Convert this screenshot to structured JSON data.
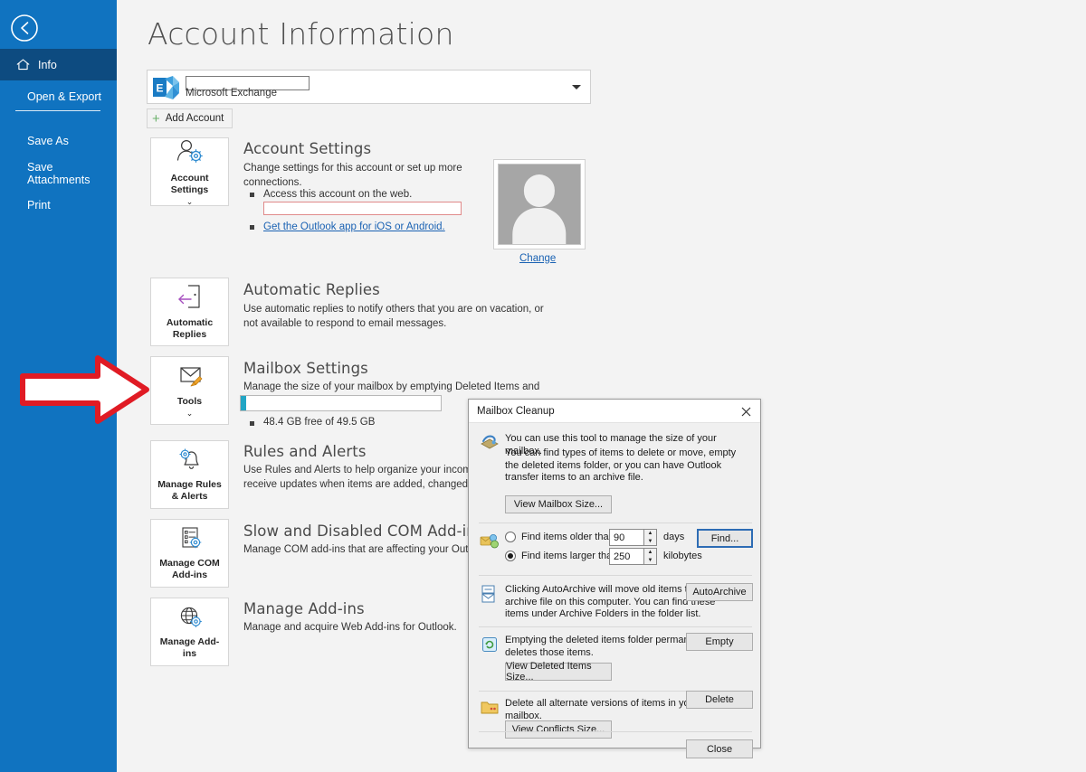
{
  "sidebar": {
    "back_icon": "back-arrow-icon",
    "items": [
      {
        "label": "Info",
        "icon": "home-icon",
        "selected": true
      },
      {
        "label": "Open & Export",
        "icon": "",
        "selected": false
      },
      {
        "label": "Save As",
        "icon": "",
        "selected": false
      },
      {
        "label": "Save Attachments",
        "icon": "",
        "selected": false
      },
      {
        "label": "Print",
        "icon": "",
        "selected": false
      }
    ]
  },
  "main": {
    "page_title": "Account Information",
    "account_selector": {
      "email_value": "",
      "account_type": "Microsoft Exchange",
      "logo_letter": "E",
      "caret_icon": "chevron-down-icon"
    },
    "add_account_label": "Add Account",
    "sections": [
      {
        "tile_label": "Account Settings",
        "tile_icon": "person-gear-icon",
        "tile_has_chevron": true,
        "title": "Account Settings",
        "desc": "Change settings for this account or set up more connections.",
        "bullets": [
          {
            "text": "Access this account on the web.",
            "link": false
          },
          {
            "text": "Get the Outlook app for iOS or Android.",
            "link": true
          }
        ]
      },
      {
        "tile_label": "Automatic Replies",
        "tile_icon": "door-exit-icon",
        "tile_has_chevron": false,
        "title": "Automatic Replies",
        "desc": "Use automatic replies to notify others that you are on vacation, or not available to respond to email messages.",
        "bullets": []
      },
      {
        "tile_label": "Tools",
        "tile_icon": "mailbox-broom-icon",
        "tile_has_chevron": true,
        "title": "Mailbox Settings",
        "desc": "Manage the size of your mailbox by emptying Deleted Items and archiving.",
        "usage_text": "48.4 GB free of 49.5 GB",
        "usage_percent": 2
      },
      {
        "tile_label": "Manage Rules & Alerts",
        "tile_icon": "bell-gear-icon",
        "tile_has_chevron": false,
        "title": "Rules and Alerts",
        "desc": "Use Rules and Alerts to help organize your incoming email messages, and receive updates when items are added, changed, or removed.",
        "bullets": []
      },
      {
        "tile_label": "Manage COM Add-ins",
        "tile_icon": "list-gear-icon",
        "tile_has_chevron": false,
        "title": "Slow and Disabled COM Add-ins",
        "desc": "Manage COM add-ins that are affecting your Outlook experience.",
        "bullets": []
      },
      {
        "tile_label": "Manage Add-ins",
        "tile_icon": "globe-gear-icon",
        "tile_has_chevron": false,
        "title": "Manage Add-ins",
        "desc": "Manage and acquire Web Add-ins for Outlook.",
        "bullets": []
      }
    ],
    "profile": {
      "avatar_icon": "user-avatar-placeholder",
      "change_label": "Change"
    }
  },
  "dialog": {
    "title": "Mailbox Cleanup",
    "close_icon": "close-icon",
    "section_info": {
      "icon": "mailbox-tool-icon",
      "line1": "You can use this tool to manage the size of your mailbox.",
      "line2": "You can find types of items to delete or move, empty the deleted items folder, or you can have Outlook transfer items to an archive file.",
      "button": "View Mailbox Size..."
    },
    "section_find": {
      "icon": "find-items-icon",
      "older_label": "Find items older than",
      "older_value": "90",
      "older_unit": "days",
      "older_selected": false,
      "larger_label": "Find items larger than",
      "larger_value": "250",
      "larger_unit": "kilobytes",
      "larger_selected": true,
      "find_button": "Find..."
    },
    "section_archive": {
      "icon": "autoarchive-icon",
      "text": "Clicking AutoArchive will move old items to the archive file on this computer. You can find these items under Archive Folders in the folder list.",
      "button": "AutoArchive"
    },
    "section_deleted": {
      "icon": "recycle-bin-icon",
      "text": "Emptying the deleted items folder permanently deletes those items.",
      "button": "Empty",
      "sub_button": "View Deleted Items Size..."
    },
    "section_conflicts": {
      "icon": "conflicts-folder-icon",
      "text": "Delete all alternate versions of items in your mailbox.",
      "button": "Delete",
      "sub_button": "View Conflicts Size..."
    },
    "close_button": "Close"
  },
  "annotation": {
    "arrow_icon": "red-arrow-pointing-right",
    "arrow_color": "#e01b24"
  },
  "colors": {
    "sidebar_blue": "#1073c0",
    "sidebar_selected": "#0d4b80",
    "accent_link": "#1a62b3",
    "usage_fill": "#22a5c4",
    "annotation_red": "#e01b24"
  }
}
